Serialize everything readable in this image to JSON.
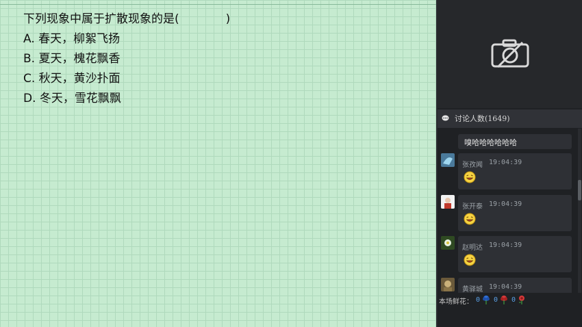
{
  "question": {
    "stem": "下列现象中属于扩散现象的是(　　　　)",
    "options": [
      "A. 春天，柳絮飞扬",
      "B. 夏天，槐花飘香",
      "C. 秋天，黄沙扑面",
      "D. 冬天，雪花飘飘"
    ]
  },
  "video": {
    "icon": "camera-off-icon"
  },
  "chat": {
    "header": "讨论人数(1649)",
    "first_message": "嗅哈哈哈哈哈哈",
    "messages": [
      {
        "name": "张孜闻",
        "time": "19:04:39",
        "emoji": "laughing-emoji-icon"
      },
      {
        "name": "张开泰",
        "time": "19:04:39",
        "emoji": "laughing-emoji-icon"
      },
      {
        "name": "赵明达",
        "time": "19:04:39",
        "emoji": "laughing-emoji-icon"
      },
      {
        "name": "黄驿城",
        "time": "19:04:39"
      }
    ]
  },
  "flowers": {
    "label": "本场鲜花：",
    "counts": [
      "0",
      "0",
      "0"
    ],
    "colors": [
      "#2f6fd6",
      "#d63a3a",
      "#d63a3a"
    ]
  },
  "colors": {
    "board": "#c6ebd0",
    "grid": "#afd9bc",
    "panel": "#1f2124"
  }
}
